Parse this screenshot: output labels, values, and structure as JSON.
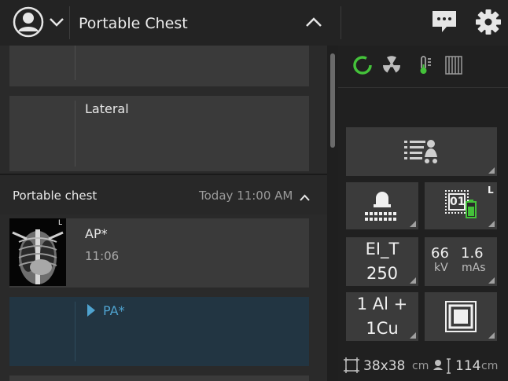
{
  "header": {
    "title": "Portable Chest"
  },
  "exam_list": {
    "cards": [
      {
        "label": ""
      },
      {
        "label": "Lateral"
      }
    ],
    "group": {
      "title": "Portable chest",
      "time": "Today  11:00 AM"
    },
    "views": [
      {
        "label": "AP*",
        "time": "11:06",
        "thumb_marker": "L"
      },
      {
        "label": "PA*"
      }
    ]
  },
  "status_icons": [
    "progress-ring-icon",
    "radiation-icon",
    "thermometer-icon",
    "detector-grid-icon"
  ],
  "colors": {
    "accent_green": "#44c23a",
    "active_blue": "#4fa3cf",
    "active_row": "#223542"
  },
  "controls": {
    "detector_badge": "L",
    "detector_label": "01",
    "ei_label": "EI_T",
    "ei_value": "250",
    "kv_value": "66",
    "kv_unit": "kV",
    "mas_value": "1.6",
    "mas_unit": "mAs",
    "filter_line1": "1 Al +",
    "filter_line2": "1Cu",
    "field_size": "38x38",
    "field_unit": "cm",
    "sid_value": "114",
    "sid_unit": "cm"
  }
}
